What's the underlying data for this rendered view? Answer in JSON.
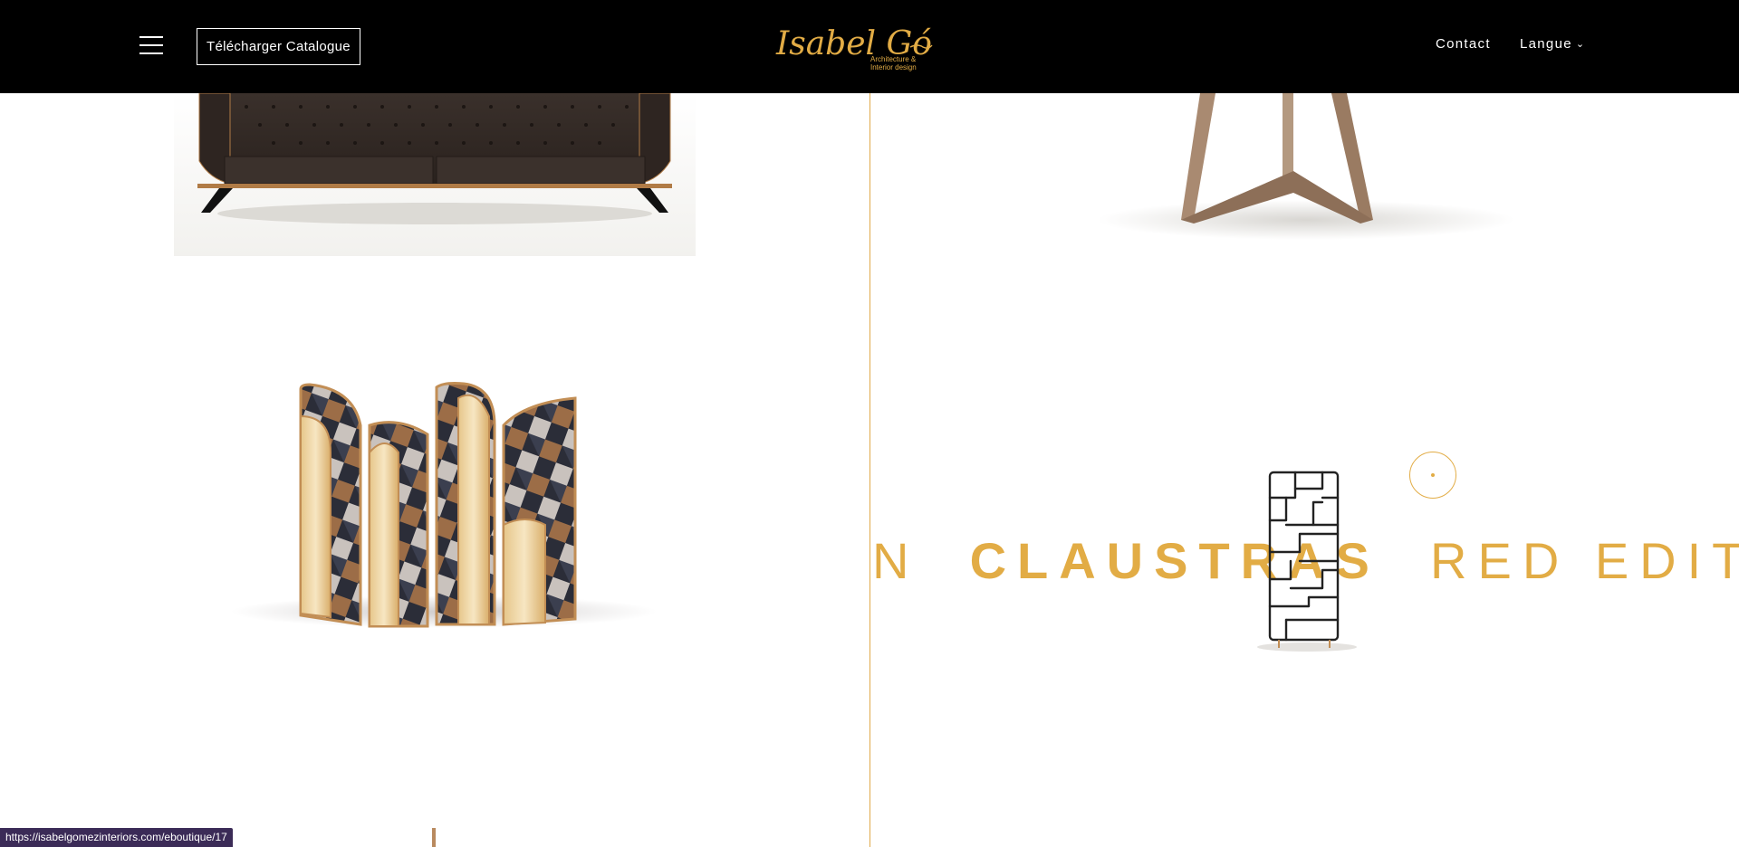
{
  "header": {
    "catalog_label": "Télécharger Catalogue",
    "logo": {
      "name": "Isabel Gómez",
      "tagline_line1": "Architecture &",
      "tagline_line2": "Interior design"
    },
    "nav": {
      "contact_label": "Contact",
      "language_label": "Langue"
    }
  },
  "feature": {
    "title_partial_before": "N",
    "title_bold": "CLAUSTRAS",
    "title_after": "RED EDITION"
  },
  "status_bar": {
    "url": "https://isabelgomezinteriors.com/eboutique/17"
  },
  "colors": {
    "accent": "#e2ac45",
    "header_bg": "#000000",
    "status_bg": "#3b2b57"
  },
  "icons": {
    "menu": "hamburger-icon",
    "language_dropdown": "chevron-down-icon",
    "circle_button": "circle-dot-icon"
  }
}
